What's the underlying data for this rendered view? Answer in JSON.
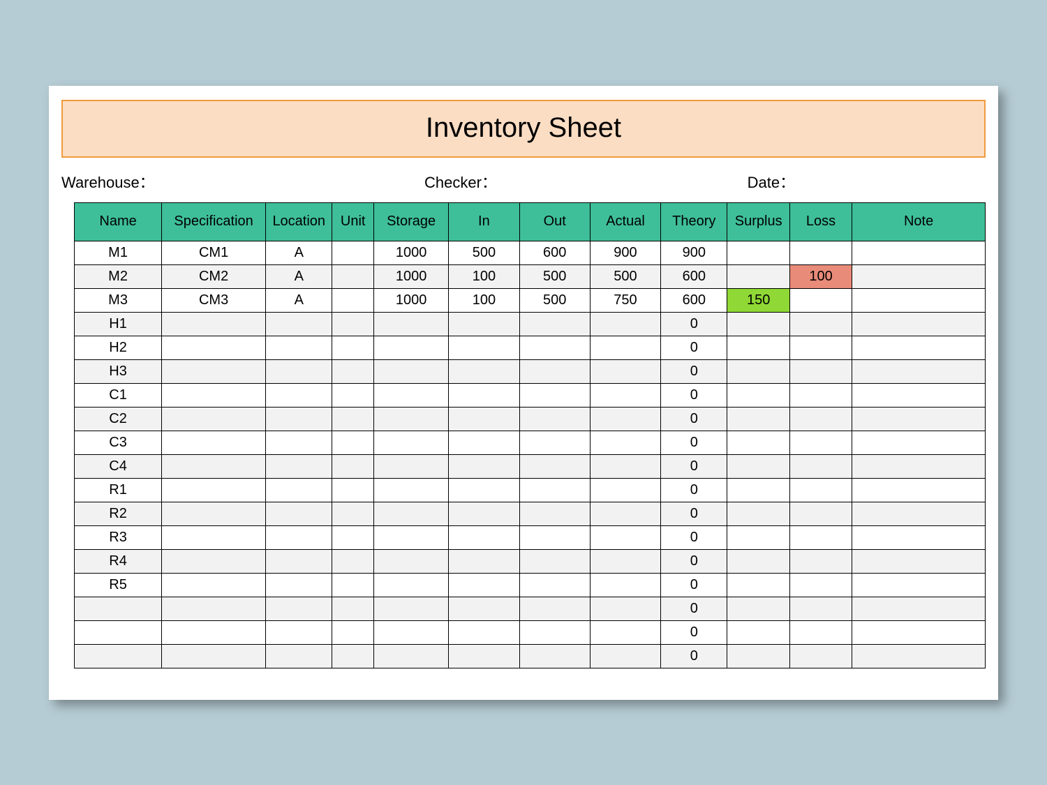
{
  "title": "Inventory Sheet",
  "meta": {
    "warehouse_label": "Warehouse：",
    "checker_label": "Checker：",
    "date_label": "Date："
  },
  "columns": [
    "Name",
    "Specification",
    "Location",
    "Unit",
    "Storage",
    "In",
    "Out",
    "Actual",
    "Theory",
    "Surplus",
    "Loss",
    "Note"
  ],
  "rows": [
    {
      "name": "M1",
      "spec": "CM1",
      "loc": "A",
      "unit": "",
      "storage": "1000",
      "in": "500",
      "out": "600",
      "actual": "900",
      "theory": "900",
      "surplus": "",
      "loss": "",
      "note": "",
      "alt": false
    },
    {
      "name": "M2",
      "spec": "CM2",
      "loc": "A",
      "unit": "",
      "storage": "1000",
      "in": "100",
      "out": "500",
      "actual": "500",
      "theory": "600",
      "surplus": "",
      "loss": "100",
      "note": "",
      "alt": true,
      "loss_flag": true
    },
    {
      "name": "M3",
      "spec": "CM3",
      "loc": "A",
      "unit": "",
      "storage": "1000",
      "in": "100",
      "out": "500",
      "actual": "750",
      "theory": "600",
      "surplus": "150",
      "loss": "",
      "note": "",
      "alt": false,
      "surplus_flag": true
    },
    {
      "name": "H1",
      "spec": "",
      "loc": "",
      "unit": "",
      "storage": "",
      "in": "",
      "out": "",
      "actual": "",
      "theory": "0",
      "surplus": "",
      "loss": "",
      "note": "",
      "alt": true
    },
    {
      "name": "H2",
      "spec": "",
      "loc": "",
      "unit": "",
      "storage": "",
      "in": "",
      "out": "",
      "actual": "",
      "theory": "0",
      "surplus": "",
      "loss": "",
      "note": "",
      "alt": false
    },
    {
      "name": "H3",
      "spec": "",
      "loc": "",
      "unit": "",
      "storage": "",
      "in": "",
      "out": "",
      "actual": "",
      "theory": "0",
      "surplus": "",
      "loss": "",
      "note": "",
      "alt": true
    },
    {
      "name": "C1",
      "spec": "",
      "loc": "",
      "unit": "",
      "storage": "",
      "in": "",
      "out": "",
      "actual": "",
      "theory": "0",
      "surplus": "",
      "loss": "",
      "note": "",
      "alt": false
    },
    {
      "name": "C2",
      "spec": "",
      "loc": "",
      "unit": "",
      "storage": "",
      "in": "",
      "out": "",
      "actual": "",
      "theory": "0",
      "surplus": "",
      "loss": "",
      "note": "",
      "alt": true
    },
    {
      "name": "C3",
      "spec": "",
      "loc": "",
      "unit": "",
      "storage": "",
      "in": "",
      "out": "",
      "actual": "",
      "theory": "0",
      "surplus": "",
      "loss": "",
      "note": "",
      "alt": false
    },
    {
      "name": "C4",
      "spec": "",
      "loc": "",
      "unit": "",
      "storage": "",
      "in": "",
      "out": "",
      "actual": "",
      "theory": "0",
      "surplus": "",
      "loss": "",
      "note": "",
      "alt": true
    },
    {
      "name": "R1",
      "spec": "",
      "loc": "",
      "unit": "",
      "storage": "",
      "in": "",
      "out": "",
      "actual": "",
      "theory": "0",
      "surplus": "",
      "loss": "",
      "note": "",
      "alt": false
    },
    {
      "name": "R2",
      "spec": "",
      "loc": "",
      "unit": "",
      "storage": "",
      "in": "",
      "out": "",
      "actual": "",
      "theory": "0",
      "surplus": "",
      "loss": "",
      "note": "",
      "alt": true
    },
    {
      "name": "R3",
      "spec": "",
      "loc": "",
      "unit": "",
      "storage": "",
      "in": "",
      "out": "",
      "actual": "",
      "theory": "0",
      "surplus": "",
      "loss": "",
      "note": "",
      "alt": false
    },
    {
      "name": "R4",
      "spec": "",
      "loc": "",
      "unit": "",
      "storage": "",
      "in": "",
      "out": "",
      "actual": "",
      "theory": "0",
      "surplus": "",
      "loss": "",
      "note": "",
      "alt": true
    },
    {
      "name": "R5",
      "spec": "",
      "loc": "",
      "unit": "",
      "storage": "",
      "in": "",
      "out": "",
      "actual": "",
      "theory": "0",
      "surplus": "",
      "loss": "",
      "note": "",
      "alt": false
    },
    {
      "name": "",
      "spec": "",
      "loc": "",
      "unit": "",
      "storage": "",
      "in": "",
      "out": "",
      "actual": "",
      "theory": "0",
      "surplus": "",
      "loss": "",
      "note": "",
      "alt": true
    },
    {
      "name": "",
      "spec": "",
      "loc": "",
      "unit": "",
      "storage": "",
      "in": "",
      "out": "",
      "actual": "",
      "theory": "0",
      "surplus": "",
      "loss": "",
      "note": "",
      "alt": false
    },
    {
      "name": "",
      "spec": "",
      "loc": "",
      "unit": "",
      "storage": "",
      "in": "",
      "out": "",
      "actual": "",
      "theory": "0",
      "surplus": "",
      "loss": "",
      "note": "",
      "alt": true
    }
  ]
}
